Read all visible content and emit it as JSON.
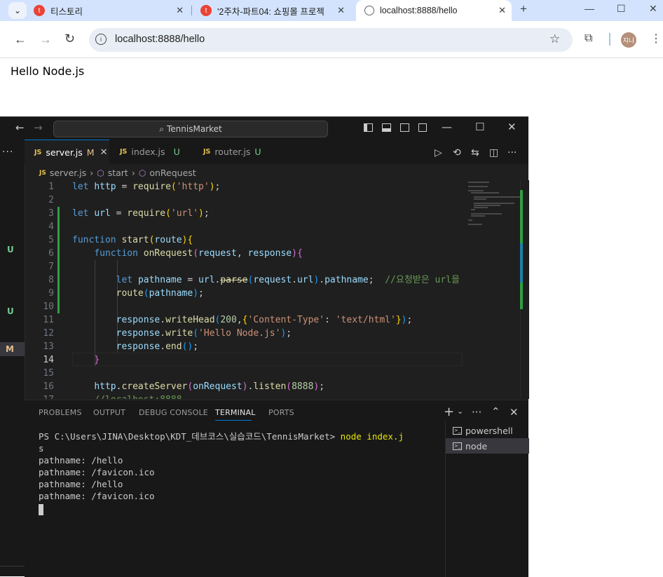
{
  "browser": {
    "tabs": [
      {
        "title": "티스토리",
        "favicon": "tistory-icon"
      },
      {
        "title": "'2주차-파트04: 쇼핑몰 프로젝",
        "favicon": "tistory-icon"
      },
      {
        "title": "localhost:8888/hello",
        "favicon": "globe-icon"
      }
    ],
    "address": "localhost:8888/hello",
    "avatar_text": "지나",
    "page_content": "Hello Node.js"
  },
  "vscode": {
    "command_center": "TennisMarket",
    "editor_tabs": [
      {
        "label": "server.js",
        "status": "M"
      },
      {
        "label": "index.js",
        "status": "U"
      },
      {
        "label": "router.js",
        "status": "U"
      }
    ],
    "breadcrumb": [
      "server.js",
      "start",
      "onRequest"
    ],
    "file_badge": "JS",
    "activity_badges": [
      "U",
      "U",
      "M"
    ],
    "code_lines": [
      {
        "n": "1",
        "text": "let http = require('http');"
      },
      {
        "n": "2",
        "text": ""
      },
      {
        "n": "3",
        "text": "let url = require('url');"
      },
      {
        "n": "4",
        "text": ""
      },
      {
        "n": "5",
        "text": "function start(route){"
      },
      {
        "n": "6",
        "text": "    function onRequest(request, response){"
      },
      {
        "n": "7",
        "text": ""
      },
      {
        "n": "8",
        "text": "        let pathname = url.parse(request.url).pathname;  //요청받은 url을"
      },
      {
        "n": "9",
        "text": "        route(pathname);"
      },
      {
        "n": "10",
        "text": ""
      },
      {
        "n": "11",
        "text": "        response.writeHead(200,{'Content-Type': 'text/html'});"
      },
      {
        "n": "12",
        "text": "        response.write('Hello Node.js');"
      },
      {
        "n": "13",
        "text": "        response.end();"
      },
      {
        "n": "14",
        "text": "    }"
      },
      {
        "n": "15",
        "text": ""
      },
      {
        "n": "16",
        "text": "    http.createServer(onRequest).listen(8888);"
      },
      {
        "n": "17",
        "text": "    //localhost:8888"
      }
    ],
    "panel_tabs": [
      "PROBLEMS",
      "OUTPUT",
      "DEBUG CONSOLE",
      "TERMINAL",
      "PORTS"
    ],
    "terminal": {
      "prompt": "PS C:\\Users\\JINA\\Desktop\\KDT_데브코스\\실습코드\\TennisMarket>",
      "command": "node index.j",
      "wrap": "s",
      "output": [
        "pathname: /hello",
        "pathname: /favicon.ico",
        "pathname: /hello",
        "pathname: /favicon.ico"
      ]
    },
    "terminal_list": [
      "powershell",
      "node"
    ]
  }
}
